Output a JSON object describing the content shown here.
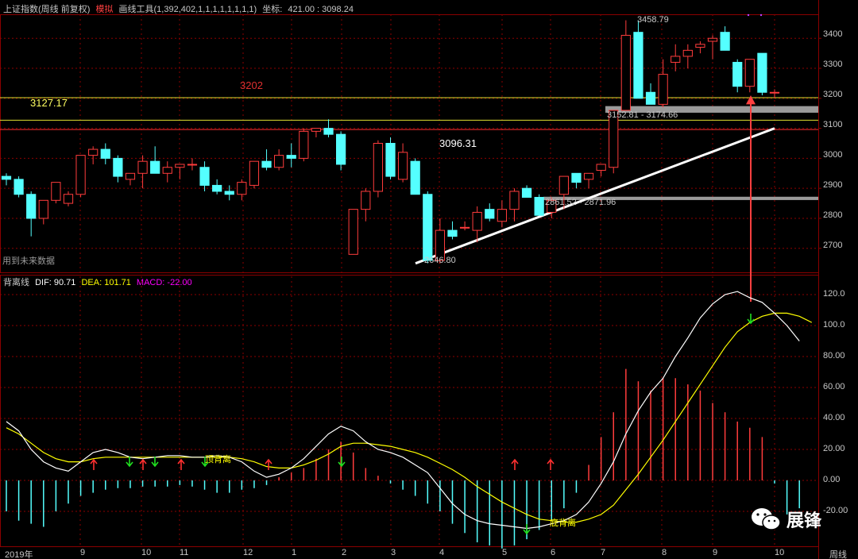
{
  "header": {
    "title": "上证指数(周线 前复权)",
    "mode": "模拟",
    "tool": "画线工具(1,392,402,1,1,1,1,1,1,1,1)",
    "coord_label": "坐标:",
    "coord_value": "421.00 : 3098.24"
  },
  "price_panel": {
    "y_ticks": [
      "3400",
      "3300",
      "3200",
      "3100",
      "3000",
      "2900",
      "2800",
      "2700"
    ],
    "note": "用到未来数据",
    "annotations": {
      "high": "3458.79",
      "low": "2646.80",
      "mid": "3096.31",
      "line_3202": "3202",
      "line_3127": "3127.17",
      "zone_upper": "3152.81 - 3174.66",
      "zone_lower": "2861.52 - 2871.96"
    }
  },
  "macd_panel": {
    "name": "背离线",
    "dif_label": "DIF: 90.71",
    "dea_label": "DEA: 101.71",
    "macd_label": "MACD: -22.00",
    "y_ticks": [
      "120.0",
      "100.0",
      "80.00",
      "60.00",
      "40.00",
      "20.00",
      "0.00",
      "-20.00"
    ],
    "top_divergence": "顶背离",
    "bottom_divergence": "底背离"
  },
  "x_axis": {
    "labels": [
      "2019年",
      "9",
      "10",
      "11",
      "12",
      "1",
      "2",
      "3",
      "4",
      "5",
      "6",
      "7",
      "8",
      "9",
      "10"
    ],
    "period": "周线"
  },
  "watermark": "展锋",
  "colors": {
    "up": "#ff3c3c",
    "down": "#54ffff",
    "dif": "#ffffff",
    "dea": "#ffff00",
    "macd": "#ff00ff",
    "grid": "#8b0000"
  },
  "chart_data": {
    "type": "candlestick",
    "candles": [
      [
        2940,
        2950,
        2910,
        2930
      ],
      [
        2930,
        2940,
        2870,
        2880
      ],
      [
        2880,
        2890,
        2740,
        2800
      ],
      [
        2800,
        2860,
        2780,
        2860
      ],
      [
        2860,
        2920,
        2850,
        2920
      ],
      [
        2850,
        2890,
        2840,
        2880
      ],
      [
        2880,
        3010,
        2870,
        3010
      ],
      [
        3010,
        3040,
        2980,
        3030
      ],
      [
        3030,
        3050,
        2980,
        3000
      ],
      [
        3000,
        3010,
        2920,
        2940
      ],
      [
        2930,
        2950,
        2910,
        2950
      ],
      [
        2950,
        3010,
        2900,
        2990
      ],
      [
        2990,
        3040,
        2960,
        2950
      ],
      [
        2950,
        2990,
        2920,
        2970
      ],
      [
        2970,
        2980,
        2930,
        2980
      ],
      [
        2980,
        3000,
        2960,
        2980
      ],
      [
        2970,
        2990,
        2890,
        2910
      ],
      [
        2910,
        2930,
        2880,
        2890
      ],
      [
        2890,
        2910,
        2860,
        2880
      ],
      [
        2880,
        2930,
        2860,
        2920
      ],
      [
        2910,
        2960,
        2900,
        2990
      ],
      [
        2990,
        3030,
        2960,
        2970
      ],
      [
        2970,
        3030,
        2960,
        3010
      ],
      [
        3010,
        3050,
        2970,
        3000
      ],
      [
        3000,
        3100,
        2990,
        3090
      ],
      [
        3090,
        3100,
        3070,
        3100
      ],
      [
        3100,
        3130,
        3070,
        3080
      ],
      [
        3080,
        3090,
        2960,
        2980
      ],
      [
        2680,
        2810,
        2690,
        2830
      ],
      [
        2830,
        2900,
        2790,
        2890
      ],
      [
        2890,
        3060,
        2870,
        3050
      ],
      [
        3050,
        3070,
        2930,
        2940
      ],
      [
        2930,
        3050,
        2920,
        3020
      ],
      [
        2990,
        3000,
        2880,
        2880
      ],
      [
        2880,
        2890,
        2650,
        2660
      ],
      [
        2660,
        2800,
        2650,
        2760
      ],
      [
        2760,
        2790,
        2730,
        2740
      ],
      [
        2770,
        2790,
        2760,
        2770
      ],
      [
        2760,
        2840,
        2720,
        2820
      ],
      [
        2830,
        2850,
        2790,
        2800
      ],
      [
        2790,
        2860,
        2770,
        2830
      ],
      [
        2830,
        2900,
        2790,
        2890
      ],
      [
        2900,
        2910,
        2870,
        2870
      ],
      [
        2870,
        2880,
        2810,
        2810
      ],
      [
        2820,
        2870,
        2800,
        2860
      ],
      [
        2880,
        2940,
        2830,
        2940
      ],
      [
        2950,
        2950,
        2900,
        2920
      ],
      [
        2930,
        2950,
        2900,
        2950
      ],
      [
        2960,
        2980,
        2940,
        2980
      ],
      [
        2970,
        3150,
        2950,
        3160
      ],
      [
        3160,
        3460,
        3170,
        3410
      ],
      [
        3420,
        3460,
        3200,
        3200
      ],
      [
        3220,
        3250,
        3180,
        3180
      ],
      [
        3180,
        3330,
        3170,
        3280
      ],
      [
        3320,
        3380,
        3290,
        3340
      ],
      [
        3340,
        3380,
        3300,
        3360
      ],
      [
        3370,
        3390,
        3350,
        3380
      ],
      [
        3390,
        3410,
        3330,
        3400
      ],
      [
        3420,
        3440,
        3360,
        3360
      ],
      [
        3320,
        3330,
        3220,
        3240
      ],
      [
        3240,
        3320,
        3220,
        3330
      ],
      [
        3350,
        3350,
        3210,
        3220
      ],
      [
        3220,
        3230,
        3200,
        3220
      ]
    ],
    "ylim": [
      2620,
      3480
    ],
    "macd": {
      "dif": [
        38,
        32,
        20,
        12,
        8,
        6,
        12,
        18,
        20,
        18,
        15,
        14,
        15,
        16,
        16,
        15,
        15,
        16,
        15,
        12,
        6,
        2,
        4,
        8,
        14,
        22,
        30,
        35,
        32,
        25,
        20,
        18,
        15,
        10,
        5,
        -5,
        -15,
        -22,
        -26,
        -28,
        -29,
        -30,
        -31,
        -30,
        -28,
        -26,
        -22,
        -14,
        -2,
        12,
        30,
        45,
        57,
        66,
        80,
        92,
        105,
        114,
        120,
        122,
        118,
        115,
        108,
        100,
        90
      ],
      "dea": [
        34,
        30,
        24,
        18,
        14,
        12,
        12,
        14,
        15,
        15,
        15,
        15,
        15,
        15,
        15,
        15,
        15,
        15,
        15,
        14,
        12,
        9,
        8,
        8,
        10,
        13,
        17,
        22,
        24,
        24,
        23,
        22,
        20,
        18,
        15,
        11,
        7,
        2,
        -4,
        -9,
        -14,
        -18,
        -22,
        -25,
        -26,
        -27,
        -27,
        -25,
        -22,
        -16,
        -6,
        4,
        15,
        26,
        38,
        50,
        62,
        74,
        86,
        96,
        102,
        106,
        108,
        108,
        106,
        102
      ],
      "hist": [
        -20,
        -26,
        -28,
        -30,
        -20,
        -15,
        -10,
        -8,
        -6,
        -5,
        -5,
        -4,
        -4,
        -4,
        -3,
        -4,
        -6,
        -8,
        -8,
        -6,
        -5,
        -3,
        2,
        5,
        8,
        14,
        20,
        25,
        18,
        8,
        3,
        -2,
        -6,
        -10,
        -15,
        -20,
        -28,
        -34,
        -40,
        -42,
        -44,
        -42,
        -38,
        -32,
        -26,
        -18,
        -8,
        10,
        28,
        44,
        72,
        64,
        58,
        66,
        66,
        62,
        58,
        50,
        44,
        38,
        34,
        28,
        -2,
        -22,
        -18
      ]
    }
  }
}
